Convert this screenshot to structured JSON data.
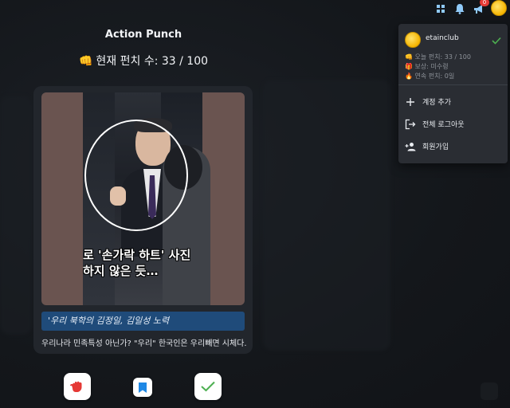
{
  "header": {
    "app_title": "Action Punch",
    "punch_count_label": "현재 펀치 수: 33 / 100",
    "fist_emoji": "👊"
  },
  "topbar": {
    "icons": [
      "grid-icon",
      "bell-icon",
      "megaphone-icon",
      "avatar"
    ],
    "notification_badge": "0"
  },
  "card": {
    "image_caption_line1": "로 '손가락 하트' 사진",
    "image_caption_line2": "하지 않은 듯…",
    "quote": "'우리 북학의 김정일, 김일성 노력",
    "comment": "우리나라 민족특성 아닌가? \"우리\" 한국인은 우리빼면 시체다."
  },
  "actions": {
    "punch": "punch-button",
    "bookmark": "bookmark-button",
    "confirm": "confirm-button"
  },
  "account_menu": {
    "username": "etainclub",
    "stats": [
      {
        "emoji": "👊",
        "label": "오늘 펀치: 33 / 100"
      },
      {
        "emoji": "🎁",
        "label": "보상: 미수령"
      },
      {
        "emoji": "🔥",
        "label": "연속 펀치: 0일"
      }
    ],
    "items": [
      {
        "icon": "plus-icon",
        "label": "계정 추가"
      },
      {
        "icon": "logout-icon",
        "label": "전체 로그아웃"
      },
      {
        "icon": "add-person-icon",
        "label": "회원가입"
      }
    ]
  },
  "colors": {
    "background": "#15181d",
    "card": "#22262c",
    "quote_bg": "#1f4b7a",
    "check_green": "#4caf50",
    "punch_red": "#e53935",
    "bookmark_blue": "#1e88e5"
  }
}
